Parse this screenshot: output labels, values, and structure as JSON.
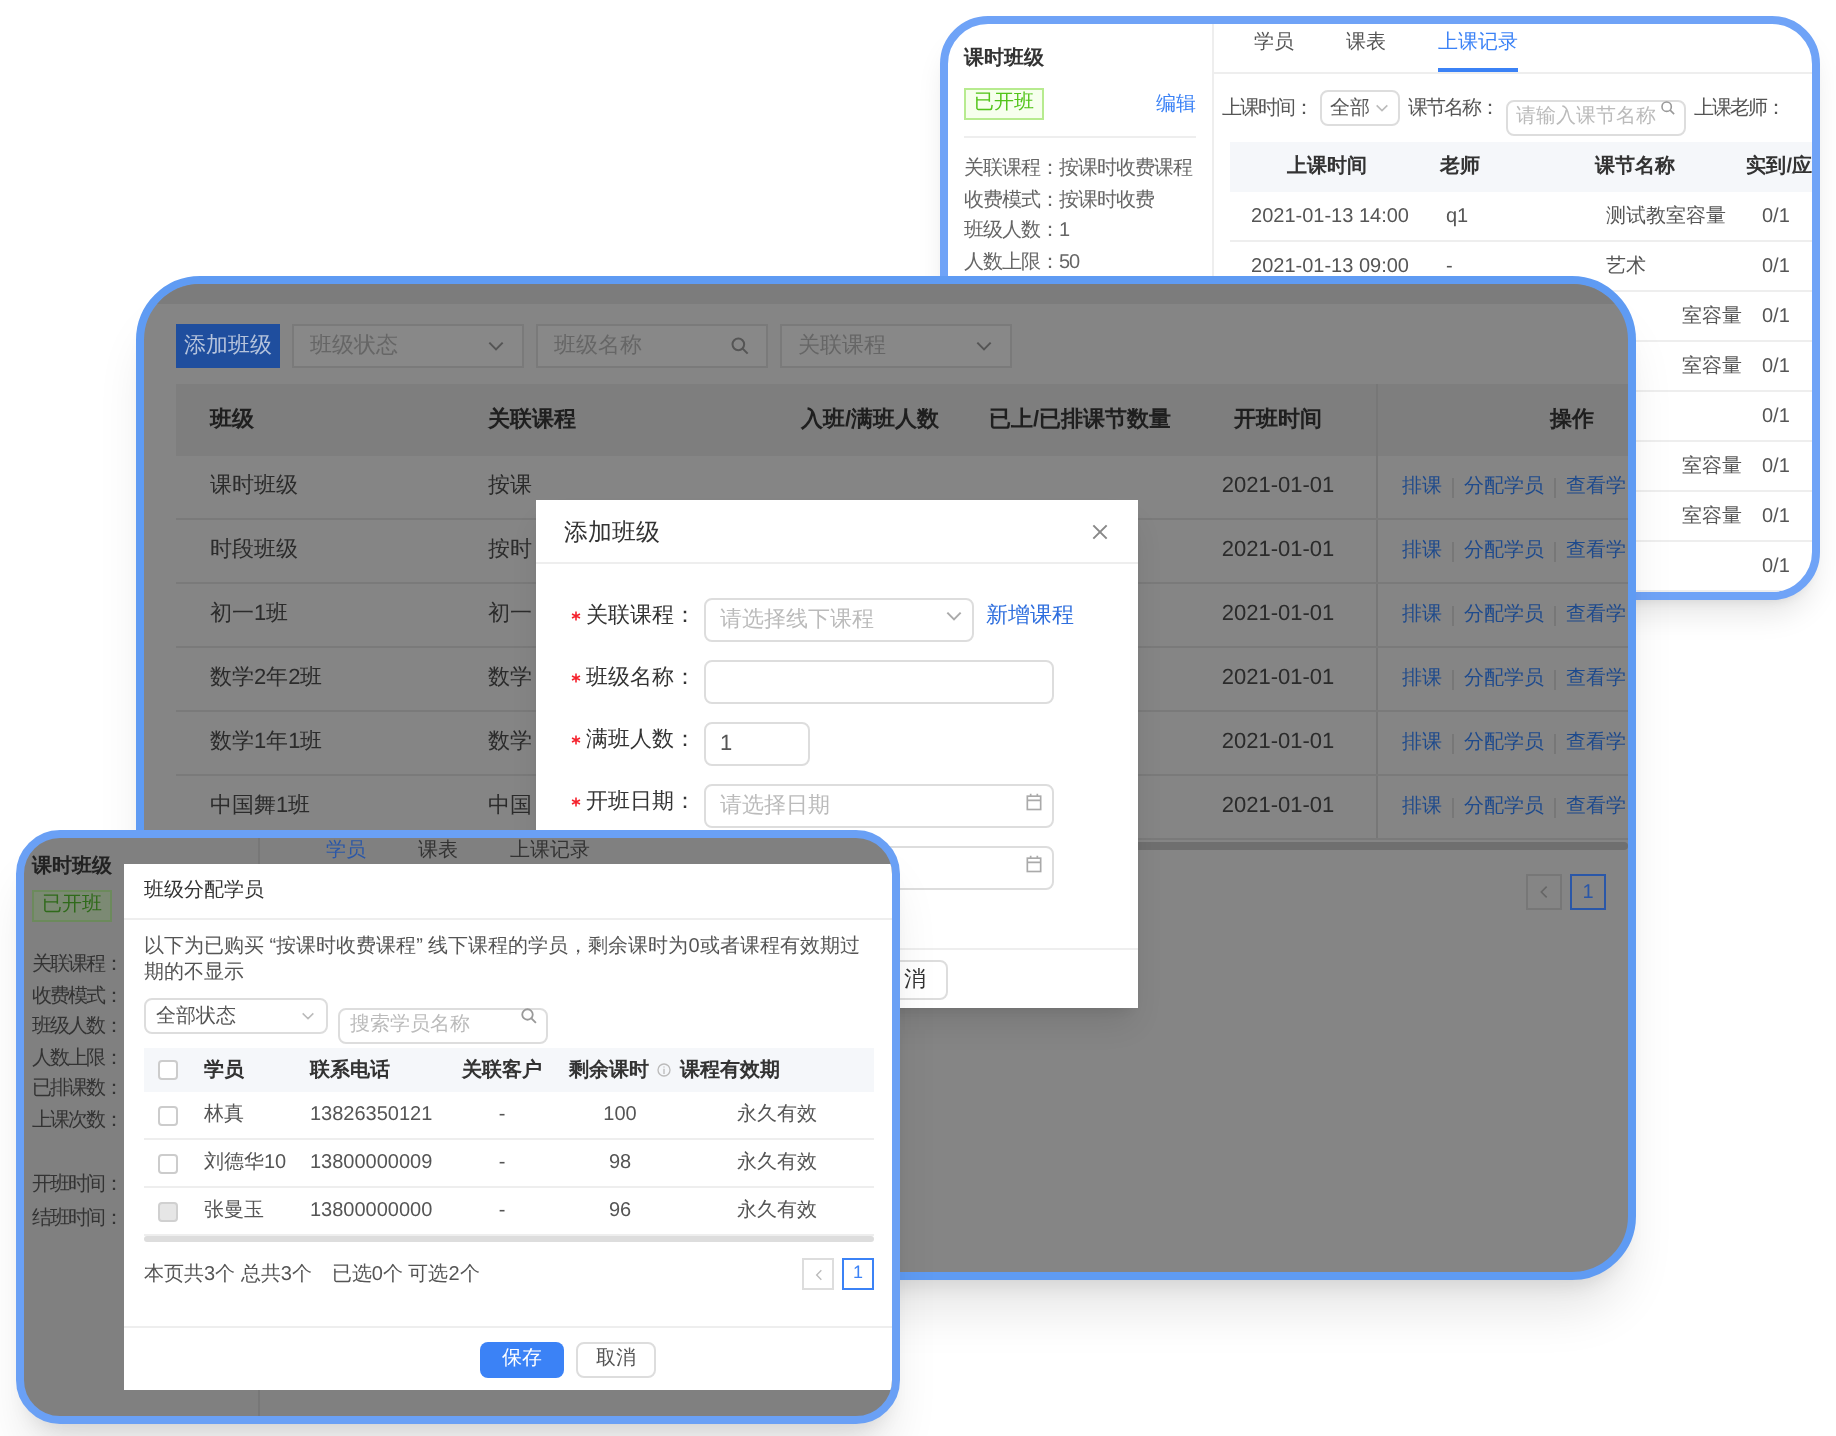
{
  "back_window": {
    "class_panel": {
      "title": "课时班级",
      "status": "已开班",
      "edit": "编辑",
      "details": [
        "关联课程：按课时收费课程",
        "收费模式：按课时收费",
        "班级人数：1",
        "人数上限：50"
      ]
    },
    "tabs": [
      {
        "label": "学员",
        "selected": false
      },
      {
        "label": "课表",
        "selected": false
      },
      {
        "label": "上课记录",
        "selected": true
      }
    ],
    "filters": {
      "time_label": "上课时间：",
      "time_value": "全部",
      "name_label": "课节名称：",
      "name_placeholder": "请输入课节名称",
      "teacher_label": "上课老师："
    },
    "table": {
      "columns": [
        "上课时间",
        "老师",
        "课节名称",
        "实到/应"
      ],
      "rows": [
        {
          "cells": [
            "2021-01-13 14:00",
            "q1",
            "测试教室容量",
            "0/1"
          ],
          "clipped": false
        },
        {
          "cells": [
            "2021-01-13 09:00",
            "-",
            "艺术",
            "0/1"
          ],
          "clipped": false
        },
        {
          "cells": [
            "",
            "",
            "室容量",
            "0/1"
          ],
          "clipped": true
        },
        {
          "cells": [
            "",
            "",
            "室容量",
            "0/1"
          ],
          "clipped": true
        },
        {
          "cells": [
            "",
            "",
            "",
            "0/1"
          ]
        },
        {
          "cells": [
            "",
            "",
            "室容量",
            "0/1"
          ],
          "clipped": true
        },
        {
          "cells": [
            "",
            "",
            "室容量",
            "0/1"
          ],
          "clipped": true
        },
        {
          "cells": [
            "",
            "",
            "",
            "0/1"
          ]
        }
      ]
    }
  },
  "class_list_window": {
    "add_button": "添加班级",
    "status_select": "班级状态",
    "name_search": "班级名称",
    "course_select": "关联课程",
    "table": {
      "columns": [
        "班级",
        "关联课程",
        "入班/满班人数",
        "已上/已排课节数量",
        "开班时间",
        "操作"
      ],
      "rows": [
        {
          "name": "课时班级",
          "course": "按课",
          "start": "2021-01-01",
          "actions": [
            "排课",
            "分配学员",
            "查看学"
          ]
        },
        {
          "name": "时段班级",
          "course": "按时",
          "start": "2021-01-01",
          "actions": [
            "排课",
            "分配学员",
            "查看学"
          ]
        },
        {
          "name": "初一1班",
          "course": "初一",
          "start": "2021-01-01",
          "actions": [
            "排课",
            "分配学员",
            "查看学"
          ]
        },
        {
          "name": "数学2年2班",
          "course": "数学",
          "start": "2021-01-01",
          "actions": [
            "排课",
            "分配学员",
            "查看学"
          ]
        },
        {
          "name": "数学1年1班",
          "course": "数学",
          "start": "2021-01-01",
          "actions": [
            "排课",
            "分配学员",
            "查看学"
          ]
        },
        {
          "name": "中国舞1班",
          "course": "中国",
          "start": "2021-01-01",
          "actions": [
            "排课",
            "分配学员",
            "查看学"
          ]
        }
      ]
    },
    "pagination": [
      {
        "label": "1",
        "selected": true
      }
    ],
    "dialog": {
      "title": "添加班级",
      "fields": [
        {
          "kind": "select",
          "label": "关联课程：",
          "required": true,
          "placeholder": "请选择线下课程",
          "link": "新增课程"
        },
        {
          "kind": "text",
          "label": "班级名称：",
          "required": true
        },
        {
          "kind": "number",
          "label": "满班人数：",
          "required": true,
          "value": "1"
        },
        {
          "kind": "date",
          "label": "开班日期：",
          "required": true,
          "placeholder": "请选择日期"
        },
        {
          "kind": "date"
        }
      ],
      "footer_button": "消"
    }
  },
  "assign_window": {
    "class_panel": {
      "title": "课时班级",
      "status": "已开班",
      "details": [
        "关联课程：",
        "收费模式：",
        "班级人数：",
        "人数上限：",
        "已排课数：",
        "上课次数："
      ],
      "dates": [
        "开班时间：",
        "结班时间："
      ]
    },
    "tabs": [
      {
        "label": "学员",
        "selected": true
      },
      {
        "label": "课表",
        "selected": false
      },
      {
        "label": "上课记录",
        "selected": false
      }
    ],
    "dialog": {
      "title": "班级分配学员",
      "note": "以下为已购买 “按课时收费课程” 线下课程的学员，剩余课时为0或者课程有效期过期的不显示",
      "status_select": "全部状态",
      "search_placeholder": "搜索学员名称",
      "table": {
        "select_all_checked": false,
        "columns": [
          "学员",
          "联系电话",
          "关联客户",
          "剩余课时",
          "课程有效期"
        ],
        "rows": [
          {
            "name": "林真",
            "phone": "13826350121",
            "customer": "-",
            "remaining": "100",
            "validity": "永久有效",
            "checked": false,
            "disabled": false
          },
          {
            "name": "刘德华10",
            "phone": "13800000009",
            "customer": "-",
            "remaining": "98",
            "validity": "永久有效",
            "checked": false,
            "disabled": false
          },
          {
            "name": "张曼玉",
            "phone": "13800000000",
            "customer": "-",
            "remaining": "96",
            "validity": "永久有效",
            "checked": false,
            "disabled": true
          }
        ]
      },
      "page_count": "本页共3个 总共3个",
      "selection_count": "已选0个 可选2个",
      "pagination": [
        {
          "label": "1",
          "selected": true
        }
      ],
      "save_button": "保存",
      "cancel_button": "取消"
    }
  }
}
